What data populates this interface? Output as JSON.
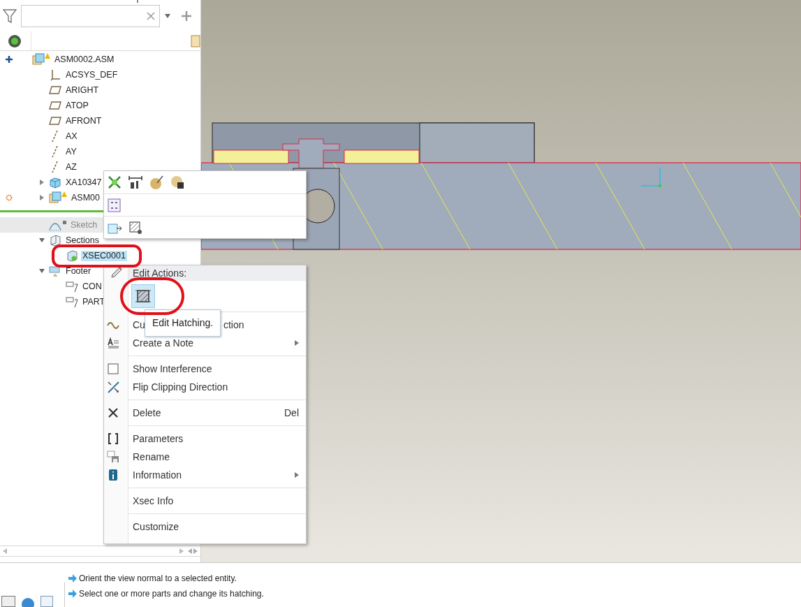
{
  "tree": {
    "root": {
      "label": "ASM0002.ASM",
      "kind": "assembly",
      "warning": true,
      "selected": false,
      "children": [
        {
          "label": "ACSYS_DEF",
          "kind": "csys",
          "selected": false
        },
        {
          "label": "ARIGHT",
          "kind": "plane",
          "selected": false
        },
        {
          "label": "ATOP",
          "kind": "plane",
          "selected": false
        },
        {
          "label": "AFRONT",
          "kind": "plane",
          "selected": false
        },
        {
          "label": "AX",
          "kind": "axis",
          "selected": false
        },
        {
          "label": "AY",
          "kind": "axis",
          "selected": false
        },
        {
          "label": "AZ",
          "kind": "axis",
          "selected": false
        },
        {
          "label": "XA10347",
          "kind": "part",
          "expanded": false,
          "selected": false
        },
        {
          "label": "ASM00",
          "kind": "assembly",
          "warning": true,
          "changed": true,
          "expanded": false,
          "selected": false
        },
        {
          "kind": "insert-marker"
        },
        {
          "label": "Sketch",
          "kind": "sketch",
          "suppressed": true,
          "selected": false
        },
        {
          "label": "Sections",
          "kind": "section-folder",
          "expanded": true,
          "selected": false,
          "children": [
            {
              "label": "XSEC0001",
              "kind": "xsec",
              "selected": true
            }
          ]
        },
        {
          "label": "Footer",
          "kind": "footer",
          "expanded": true,
          "selected": false,
          "children": [
            {
              "label": "CON",
              "kind": "note",
              "selected": false
            },
            {
              "label": "PART",
              "kind": "note",
              "selected": false
            }
          ]
        }
      ]
    }
  },
  "mini_toolbar": {
    "rows": [
      {
        "items": [
          {
            "kind": "display"
          },
          {
            "kind": "dims"
          },
          {
            "kind": "appearance"
          },
          {
            "kind": "display-style"
          }
        ]
      },
      {
        "items": [
          {
            "kind": "grid"
          }
        ]
      },
      {
        "items": [
          {
            "kind": "add-part"
          },
          {
            "kind": "hatch-edit"
          }
        ]
      }
    ]
  },
  "context_menu": {
    "header": "Edit Actions:",
    "actions": [
      {
        "kind": "hatch",
        "selected": true
      }
    ],
    "groups": [
      [
        {
          "kind": "curve",
          "label": "Cu",
          "label_end": "ction"
        },
        {
          "kind": "text-note",
          "label": "Create a Note",
          "submenu": true
        }
      ],
      [
        {
          "kind": "checkbox",
          "label": "Show Interference"
        },
        {
          "kind": "flip",
          "label": "Flip Clipping Direction"
        }
      ],
      [
        {
          "kind": "delete",
          "label": "Delete",
          "shortcut": "Del"
        }
      ],
      [
        {
          "kind": "params",
          "label": "Parameters"
        },
        {
          "kind": "rename",
          "label": "Rename"
        },
        {
          "kind": "info",
          "label": "Information",
          "submenu": true
        }
      ],
      [
        {
          "label": "Xsec Info"
        }
      ],
      [
        {
          "label": "Customize"
        }
      ]
    ]
  },
  "tooltip": {
    "text": "Edit Hatching."
  },
  "status_bar": {
    "messages": [
      "Orient the view normal to a selected entity.",
      "Select one or more parts and change its hatching."
    ]
  }
}
